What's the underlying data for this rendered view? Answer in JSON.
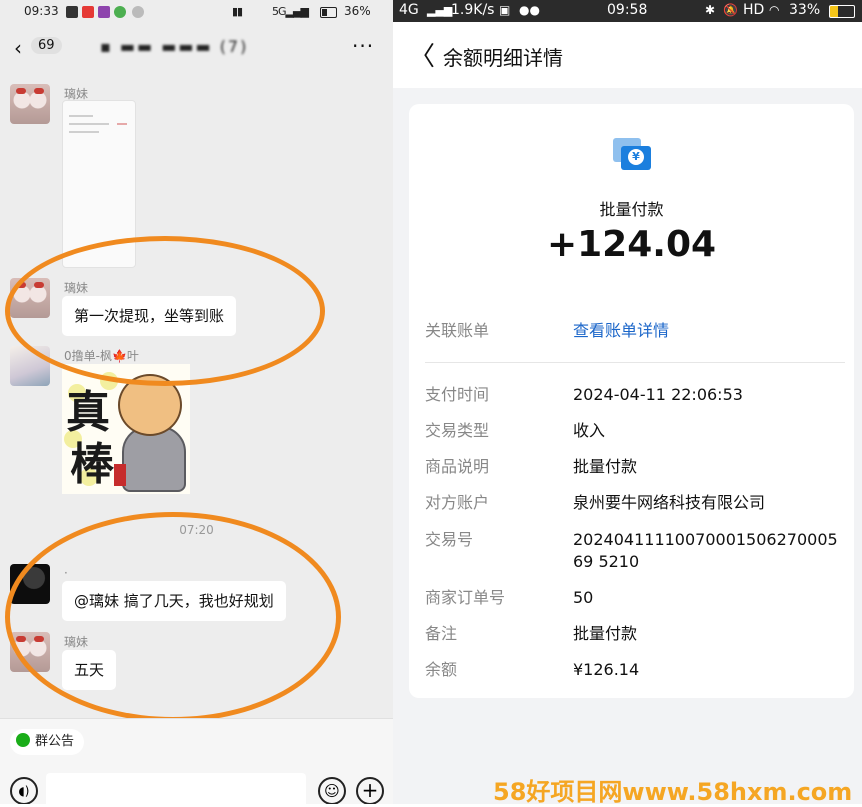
{
  "left": {
    "status": {
      "time": "09:33",
      "signal": "5G",
      "battery": "36%"
    },
    "header": {
      "unread": "69",
      "title": "(7)",
      "more": "···"
    },
    "messages": [
      {
        "sender": "璃妹",
        "text": ""
      },
      {
        "sender": "璃妹",
        "text": "第一次提现，坐等到账"
      },
      {
        "sender": "0撸单-枫🍁叶",
        "text": ""
      },
      {
        "sender": "·",
        "text": "@璃妹  搞了几天，我也好规划"
      },
      {
        "sender": "璃妹",
        "text": "五天"
      }
    ],
    "sticker_text": {
      "line1": "真",
      "line2": "棒"
    },
    "timestamp": "07:20",
    "notice_chip": "群公告",
    "accent_color": "#f08a1f"
  },
  "right": {
    "status": {
      "network": "4G",
      "speed": "1.9K/s",
      "time": "09:58",
      "hd": "HD",
      "battery": "33%"
    },
    "header": {
      "title": "余额明细详情"
    },
    "card": {
      "icon": "payment-transfer-icon",
      "transaction_name": "批量付款",
      "amount": "+124.04",
      "linked_bill": {
        "label": "关联账单",
        "value": "查看账单详情"
      },
      "rows": [
        {
          "label": "支付时间",
          "value": "2024-04-11 22:06:53"
        },
        {
          "label": "交易类型",
          "value": "收入"
        },
        {
          "label": "商品说明",
          "value": "批量付款"
        },
        {
          "label": "对方账户",
          "value": "泉州要牛网络科技有限公司"
        },
        {
          "label": "交易号",
          "value": "2024041111007000150627000569 5210"
        },
        {
          "label": "商家订单号",
          "value": "50"
        },
        {
          "label": "备注",
          "value": "批量付款"
        },
        {
          "label": "余额",
          "value": "¥126.14"
        }
      ],
      "link_color": "#1b66c9"
    }
  },
  "watermark": "58好项目网www.58hxm.com"
}
